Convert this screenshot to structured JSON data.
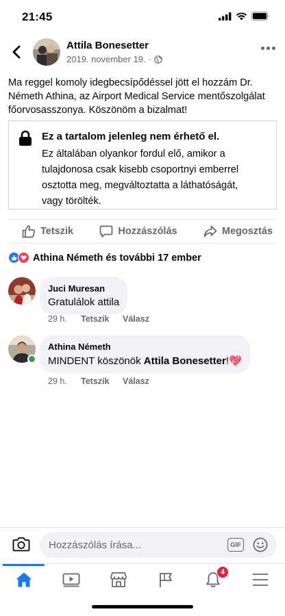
{
  "status": {
    "time": "21:45"
  },
  "post": {
    "author": "Attila Bonesetter",
    "date": "2019. november 19.",
    "separator": "·",
    "text": "Ma reggel komoly idegbecsípődéssel jött el hozzám Dr. Németh Athina, az Airport Medical Service mentőszolgálat főorvosasszonya. Köszönöm a bizalmat!",
    "unavailable_title": "Ez a tartalom jelenleg nem érhető el.",
    "unavailable_body": "Ez általában olyankor fordul elő, amikor a tulajdonosa csak kisebb csoportnyi emberrel osztotta meg, megváltoztatta a láthatóságát, vagy törölték."
  },
  "actions": {
    "like": "Tetszik",
    "comment": "Hozzászólás",
    "share": "Megosztás"
  },
  "reactions": {
    "summary": "Athina Németh és további 17 ember"
  },
  "comments": [
    {
      "name": "Juci Muresan",
      "text": "Gratulálok attila",
      "time": "29 h.",
      "like": "Tetszik",
      "reply": "Válasz"
    },
    {
      "name": "Athina Németh",
      "text_before": "MINDENT köszönök ",
      "text_mention": "Attila Bonesetter",
      "text_after": "!💖",
      "time": "29 h.",
      "like": "Tetszik",
      "reply": "Válasz"
    }
  ],
  "composer": {
    "placeholder": "Hozzászólás írása...",
    "gif": "GIF"
  },
  "tabs": {
    "notifications_badge": "4"
  },
  "colors": {
    "accent": "#1877f2",
    "secondary_text": "#65676b",
    "bubble": "#f0f2f5",
    "badge": "#e41e3f",
    "online": "#31a24c"
  }
}
